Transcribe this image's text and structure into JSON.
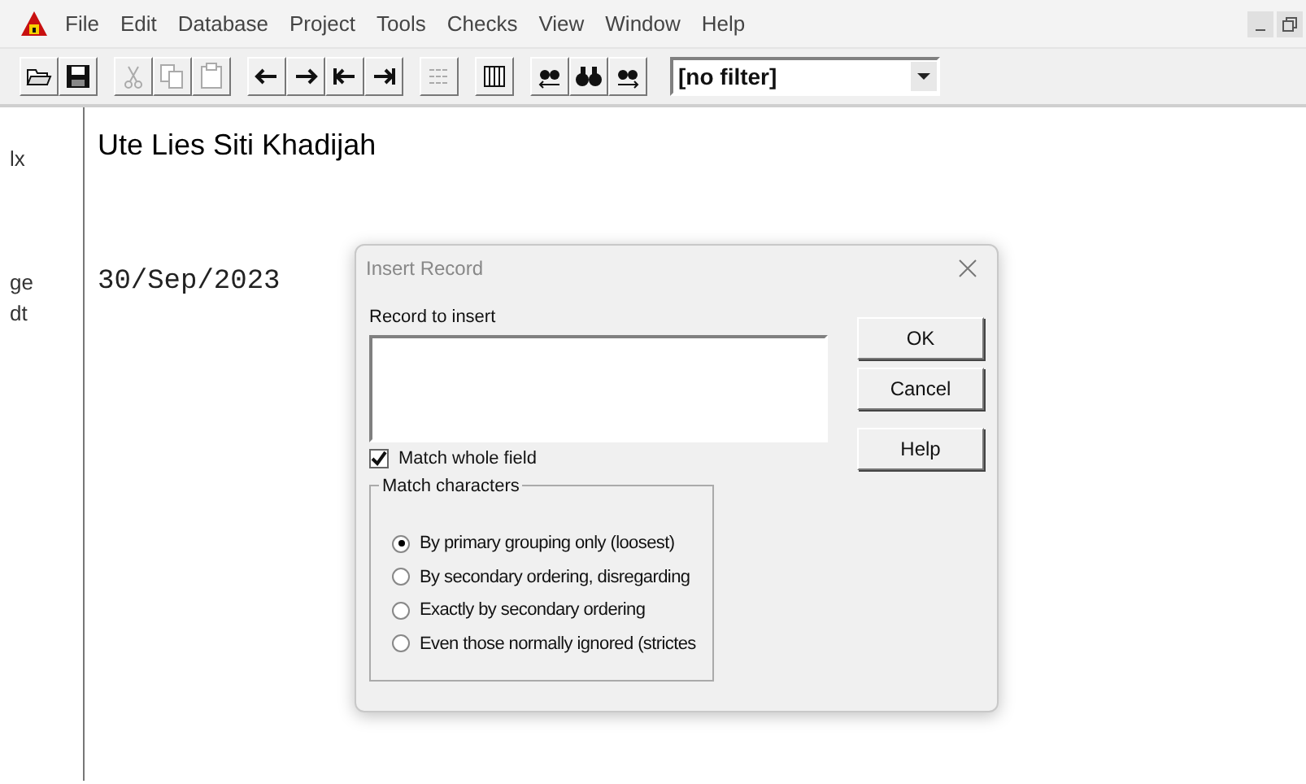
{
  "menu": [
    "File",
    "Edit",
    "Database",
    "Project",
    "Tools",
    "Checks",
    "View",
    "Window",
    "Help"
  ],
  "toolbar": [
    {
      "kind": "open",
      "disabled": false
    },
    {
      "kind": "save",
      "disabled": false
    },
    {
      "kind": "sep"
    },
    {
      "kind": "cut",
      "disabled": true
    },
    {
      "kind": "copy",
      "disabled": true
    },
    {
      "kind": "paste",
      "disabled": true
    },
    {
      "kind": "sep"
    },
    {
      "kind": "left",
      "disabled": false
    },
    {
      "kind": "right",
      "disabled": false
    },
    {
      "kind": "first",
      "disabled": false
    },
    {
      "kind": "last",
      "disabled": false
    },
    {
      "kind": "sep"
    },
    {
      "kind": "list",
      "disabled": true
    },
    {
      "kind": "sep"
    },
    {
      "kind": "columns",
      "disabled": false
    },
    {
      "kind": "sep"
    },
    {
      "kind": "findprev",
      "disabled": false
    },
    {
      "kind": "find",
      "disabled": false
    },
    {
      "kind": "findnext",
      "disabled": false
    }
  ],
  "filter": {
    "value": "[no filter]"
  },
  "record": {
    "labels": [
      "lx",
      "ge",
      "dt"
    ],
    "name": "Ute Lies Siti Khadijah",
    "date": "30/Sep/2023"
  },
  "dialog": {
    "title": "Insert Record",
    "field_label": "Record to insert",
    "match_whole": {
      "label": "Match whole field",
      "checked": true
    },
    "group": "Match characters",
    "options": [
      {
        "label": "By primary grouping only (loosest)",
        "selected": true
      },
      {
        "label": "By secondary ordering, disregarding",
        "selected": false
      },
      {
        "label": "Exactly by secondary ordering",
        "selected": false
      },
      {
        "label": "Even those normally ignored (strictes",
        "selected": false
      }
    ],
    "buttons": [
      "OK",
      "Cancel",
      "Help"
    ]
  }
}
